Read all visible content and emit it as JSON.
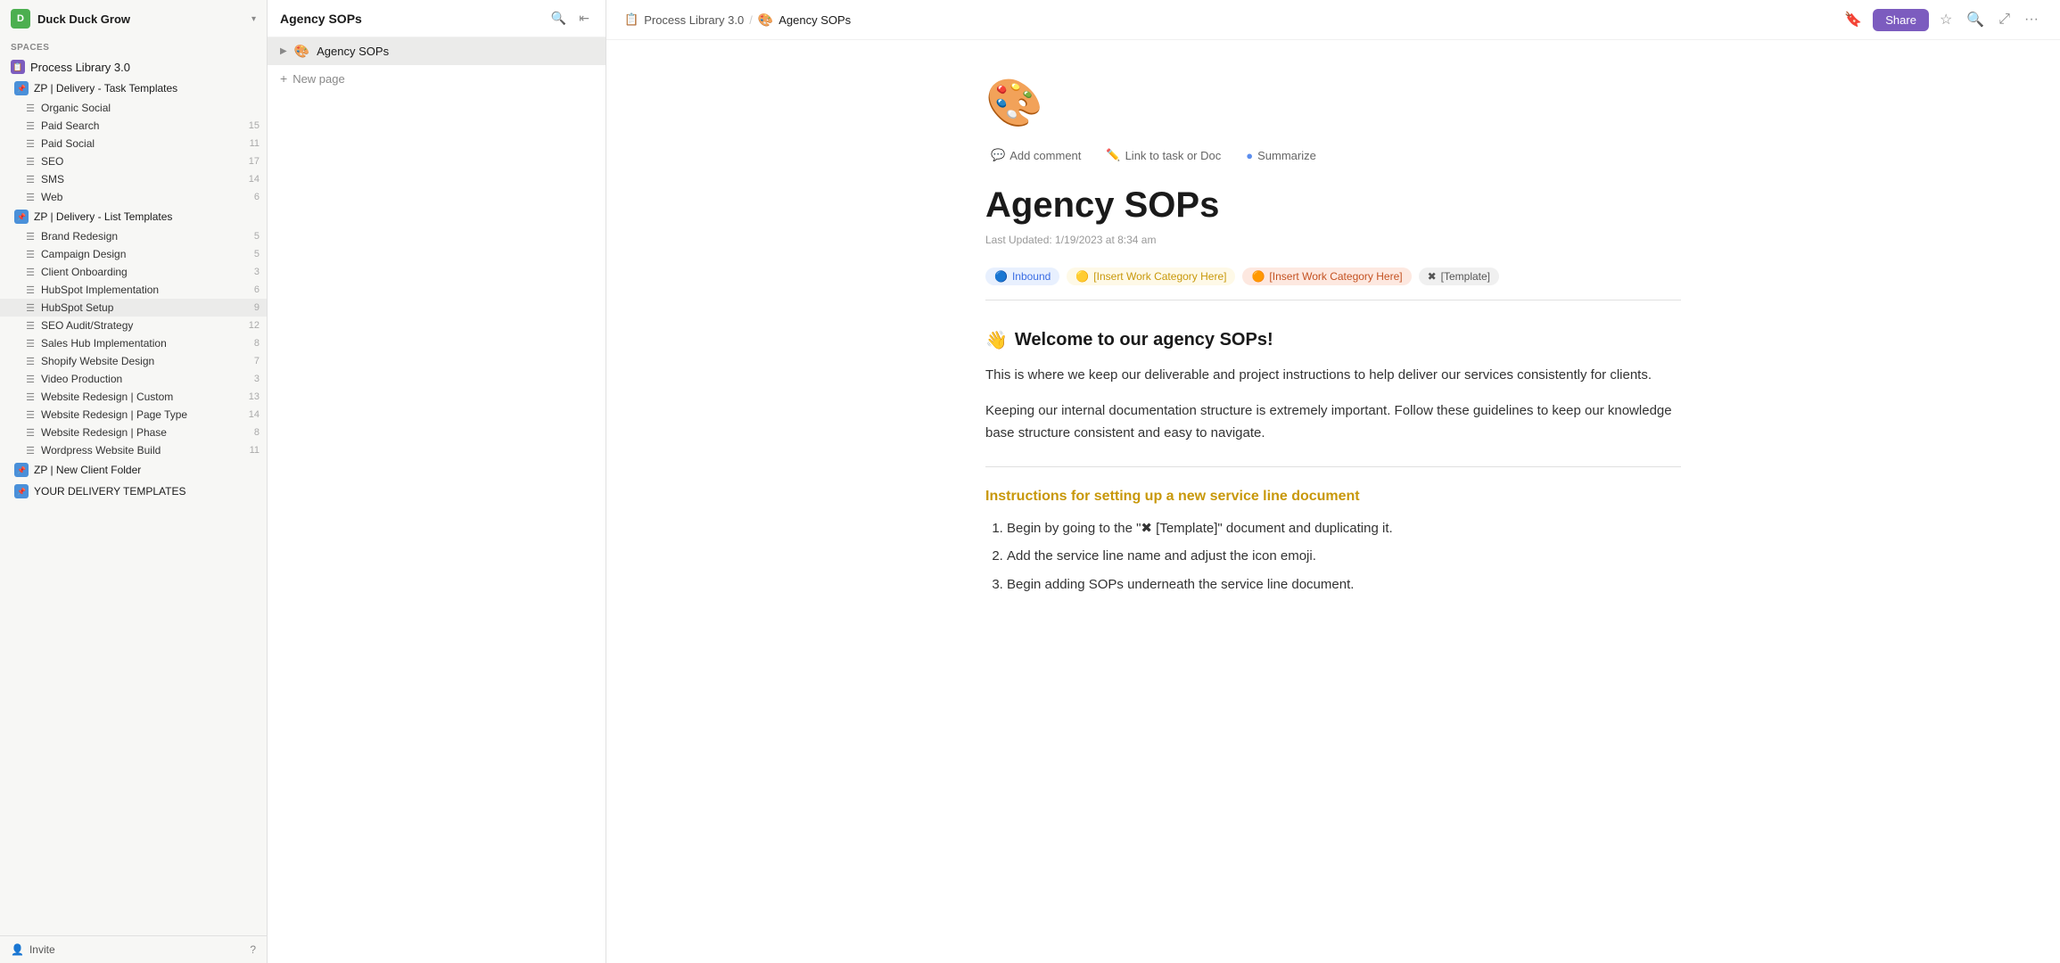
{
  "workspace": {
    "name": "Duck Duck Grow",
    "avatar_letter": "D"
  },
  "sidebar": {
    "spaces_label": "SPACES",
    "space": {
      "name": "Process Library 3.0",
      "icon": "📋"
    },
    "folders": [
      {
        "name": "ZP | Delivery - Task Templates",
        "lists": [
          {
            "name": "Organic Social",
            "count": ""
          },
          {
            "name": "Paid Search",
            "count": "15"
          },
          {
            "name": "Paid Social",
            "count": "11"
          },
          {
            "name": "SEO",
            "count": "17"
          },
          {
            "name": "SMS",
            "count": "14"
          },
          {
            "name": "Web",
            "count": "6"
          }
        ]
      },
      {
        "name": "ZP | Delivery - List Templates",
        "lists": [
          {
            "name": "Brand Redesign",
            "count": "5"
          },
          {
            "name": "Campaign Design",
            "count": "5"
          },
          {
            "name": "Client Onboarding",
            "count": "3"
          },
          {
            "name": "HubSpot Implementation",
            "count": "6"
          },
          {
            "name": "HubSpot Setup",
            "count": "9"
          },
          {
            "name": "SEO Audit/Strategy",
            "count": "12"
          },
          {
            "name": "Sales Hub Implementation",
            "count": "8"
          },
          {
            "name": "Shopify Website Design",
            "count": "7"
          },
          {
            "name": "Video Production",
            "count": "3"
          },
          {
            "name": "Website Redesign | Custom",
            "count": "13"
          },
          {
            "name": "Website Redesign | Page Type",
            "count": "14"
          },
          {
            "name": "Website Redesign | Phase",
            "count": "8"
          },
          {
            "name": "Wordpress Website Build",
            "count": "11"
          }
        ]
      },
      {
        "name": "ZP | New Client Folder",
        "lists": []
      },
      {
        "name": "YOUR DELIVERY TEMPLATES",
        "lists": []
      }
    ],
    "invite_label": "Invite"
  },
  "middle_panel": {
    "title": "Agency SOPs",
    "doc_item": {
      "emoji": "🎨",
      "name": "Agency SOPs"
    },
    "new_page_label": "New page"
  },
  "topbar": {
    "breadcrumb_space_icon": "📋",
    "breadcrumb_space": "Process Library 3.0",
    "breadcrumb_doc_emoji": "🎨",
    "breadcrumb_doc": "Agency SOPs",
    "share_label": "Share"
  },
  "document": {
    "icon_emoji": "🎨",
    "title": "Agency SOPs",
    "updated": "Last Updated: 1/19/2023 at 8:34 am",
    "toolbar": {
      "add_comment": "Add comment",
      "link_task": "Link to task or Doc",
      "summarize": "Summarize"
    },
    "tags": [
      {
        "label": "Inbound",
        "color": "blue",
        "icon": "🔵"
      },
      {
        "label": "[Insert Work Category Here]",
        "color": "yellow",
        "icon": "🟡"
      },
      {
        "label": "[Insert Work Category Here]",
        "color": "orange",
        "icon": "🟠"
      },
      {
        "label": "[Template]",
        "color": "gray",
        "icon": "✖"
      }
    ],
    "welcome_emoji": "👋",
    "welcome_heading": "Welcome to our agency SOPs!",
    "paragraph1": "This is where we keep our deliverable and project instructions to help deliver our services consistently for clients.",
    "paragraph2": "Keeping our internal documentation structure is extremely important. Follow these guidelines to keep our knowledge base structure consistent and easy to navigate.",
    "instructions_heading": "Instructions for setting up a new service line document",
    "steps": [
      "Begin by going to the \"✖ [Template]\" document and duplicating it.",
      "Add the service line name and adjust the icon emoji.",
      "Begin adding SOPs underneath the service line document."
    ]
  }
}
